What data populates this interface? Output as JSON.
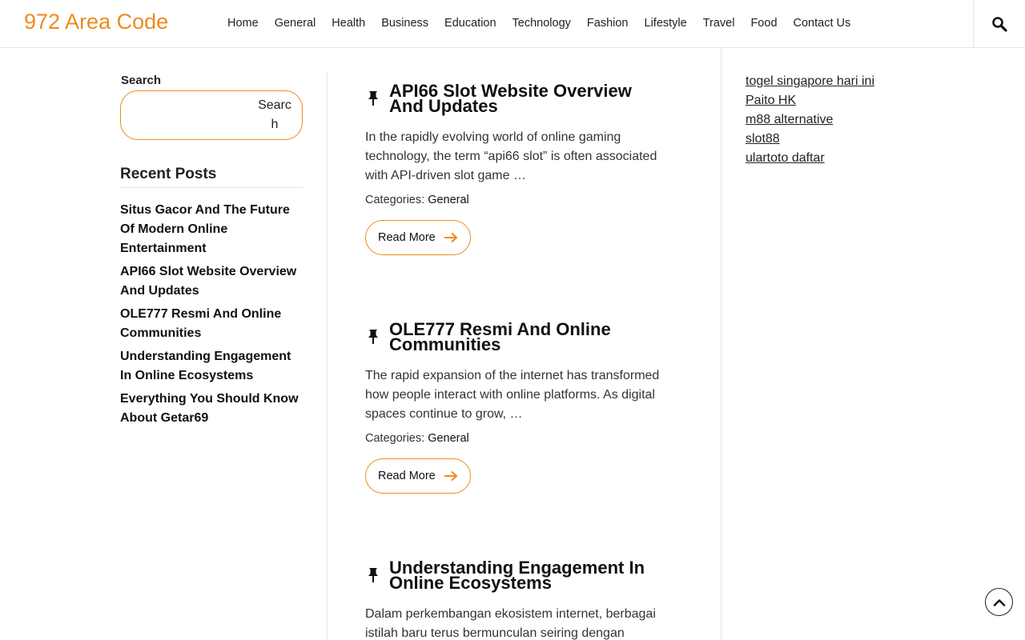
{
  "site": {
    "title": "972 Area Code",
    "accent": "#ee8a1d"
  },
  "nav": {
    "items": [
      {
        "label": "Home"
      },
      {
        "label": "General"
      },
      {
        "label": "Health"
      },
      {
        "label": "Business"
      },
      {
        "label": "Education"
      },
      {
        "label": "Technology"
      },
      {
        "label": "Fashion"
      },
      {
        "label": "Lifestyle"
      },
      {
        "label": "Travel"
      },
      {
        "label": "Food"
      },
      {
        "label": "Contact Us"
      }
    ],
    "search_icon": "search-icon"
  },
  "sidebar_left": {
    "search_label": "Search",
    "search_value": "",
    "search_button": "Search",
    "recent_title": "Recent Posts",
    "recent_posts": [
      "Situs Gacor And The Future Of Modern Online Entertainment",
      "API66 Slot Website Overview And Updates",
      "OLE777 Resmi And Online Communities",
      "Understanding Engagement In Online Ecosystems",
      "Everything You Should Know About Getar69"
    ]
  },
  "posts": [
    {
      "title": "API66 Slot Website Overview And Updates",
      "excerpt": "In the rapidly evolving world of online gaming technology, the term “api66 slot” is often associated with API-driven slot game …",
      "categories_label": "Categories:",
      "category": "General",
      "read_more": "Read More"
    },
    {
      "title": "OLE777 Resmi And Online Communities",
      "excerpt": "The rapid expansion of the internet has transformed how people interact with online platforms. As digital spaces continue to grow, …",
      "categories_label": "Categories:",
      "category": "General",
      "read_more": "Read More"
    },
    {
      "title": "Understanding Engagement In Online Ecosystems",
      "excerpt": "Dalam perkembangan ekosistem internet, berbagai istilah baru terus bermunculan seiring dengan",
      "categories_label": "",
      "category": "",
      "read_more": ""
    }
  ],
  "sidebar_right": {
    "links": [
      "togel singapore hari ini",
      "Paito HK",
      "m88 alternative",
      "slot88",
      "ulartoto daftar"
    ]
  }
}
